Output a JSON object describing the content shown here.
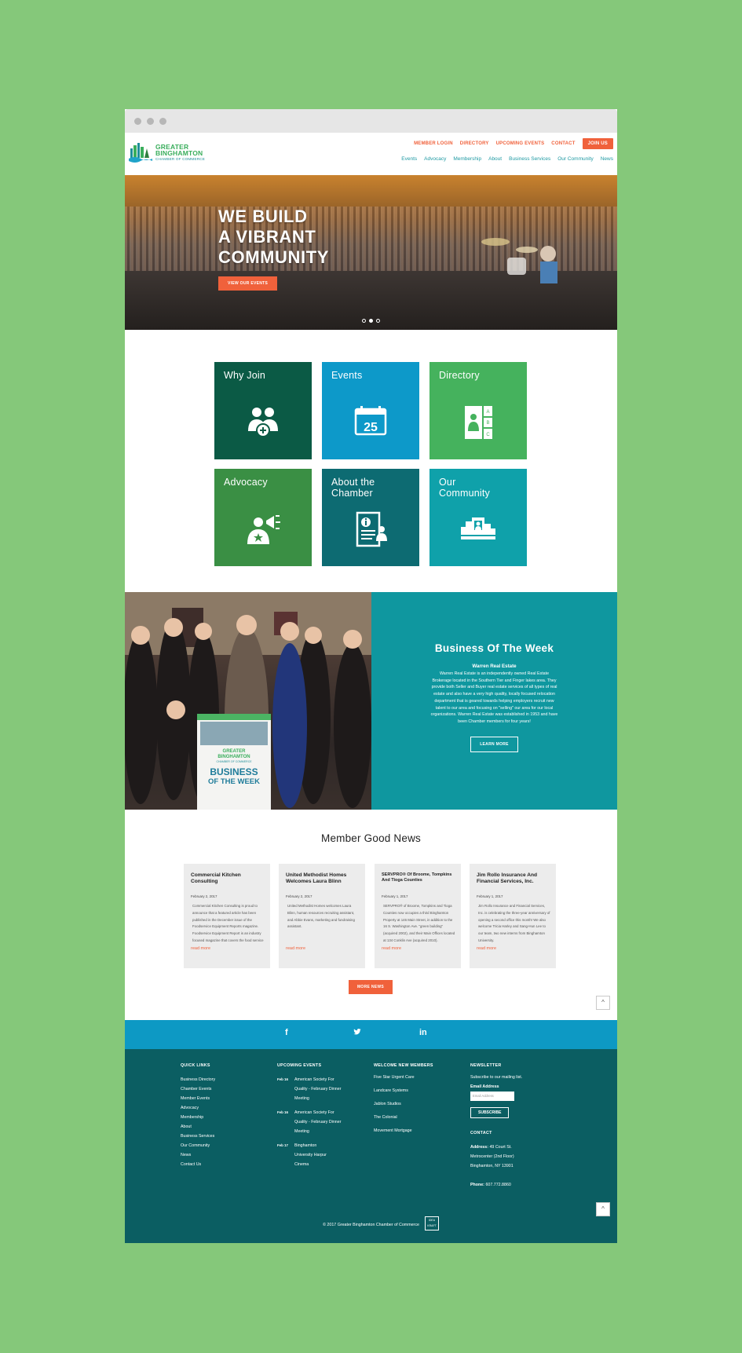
{
  "colors": {
    "background": "#85c87a",
    "accent": "#f0613b",
    "teal": "#0f979f",
    "footer": "#0b5e62",
    "social": "#0d99c4"
  },
  "logo": {
    "line1": "GREATER",
    "line2": "BINGHAMTON",
    "line3": "CHAMBER OF COMMERCE"
  },
  "topnav": [
    "MEMBER LOGIN",
    "DIRECTORY",
    "UPCOMING EVENTS",
    "CONTACT"
  ],
  "join_label": "JOIN US",
  "mainnav": [
    "Events",
    "Advocacy",
    "Membership",
    "About",
    "Business Services",
    "Our Community",
    "News"
  ],
  "hero": {
    "line1": "WE BUILD",
    "line2": "A VIBRANT",
    "line3": "COMMUNITY",
    "button": "VIEW OUR EVENTS"
  },
  "tiles": [
    {
      "label": "Why Join",
      "icon": "people-plus-icon",
      "color": "#0b5a45"
    },
    {
      "label": "Events",
      "icon": "calendar-icon",
      "color": "#0d99c9",
      "day": "25"
    },
    {
      "label": "Directory",
      "icon": "directory-icon",
      "color": "#45b25d"
    },
    {
      "label": "Advocacy",
      "icon": "megaphone-icon",
      "color": "#3a8f44"
    },
    {
      "label1": "About the",
      "label2": "Chamber",
      "icon": "info-document-icon",
      "color": "#0d6b72"
    },
    {
      "label1": "Our",
      "label2": "Community",
      "icon": "city-icon",
      "color": "#0fa1aa"
    }
  ],
  "directory_letters": [
    "A",
    "B",
    "C"
  ],
  "botw": {
    "title": "Business Of The Week",
    "business": "Warren Real Estate",
    "description": "Warren Real Estate is an independently owned Real Estate Brokerage located in the Southern Tier and Finger lakes area. They provide both Seller and Buyer real estate services of all types of real estate and also have a very high quality, locally focused relocation department that is geared towards helping employers recruit new talent to our area and focusing on \"selling\" our area for our local organizations. Warren Real Estate was established in 1953 and have been Chamber members for four years!",
    "button": "LEARN MORE",
    "sign_line1": "GREATER",
    "sign_line2": "BINGHAMTON",
    "sign_line3": "CHAMBER OF COMMERCE",
    "sign_title1": "BUSINESS",
    "sign_title2": "OF THE WEEK"
  },
  "news": {
    "title": "Member Good News",
    "more_label": "read more",
    "button": "MORE NEWS",
    "items": [
      {
        "title": "Commercial Kitchen Consulting",
        "date": "February 2, 2017",
        "body": "Commercial Kitchen Consulting is proud to announce that a featured article has been published in the December issue of the Foodservice Equipment Reports magazine. Foodservice Equipment Report is an industry focused magazine that covers the food service"
      },
      {
        "title": "United Methodist Homes Welcomes Laura Blinn",
        "date": "February 2, 2017",
        "body": "United Methodist Homes welcomes Laura Blinn, human resources recruiting assistant, and Abbie Evans, marketing and fundraising assistant."
      },
      {
        "title": "SERVPRO® Of Broome, Tompkins And Tioga Counties",
        "date": "February 1, 2017",
        "body": "SERVPRO® of Broome, Tompkins and Tioga Counties now occupies a third Binghamton Property at 146 Main Street, in addition to the 16 S. Washington Ave. \"green building\" (acquired 2002), and their Main Offices located at 134 Conklin Ave (acquired 2010)."
      },
      {
        "title": "Jim Rollo Insurance And Financial Services, Inc.",
        "date": "February 1, 2017",
        "body": "Jim Rollo Insurance and Financial Services, Inc. is celebrating the three-year anniversary of opening a second office this month! We also welcome Tricia Harley and Sang-Hun Lee to our team, two new interns from Binghamton University."
      }
    ]
  },
  "social": [
    "f",
    "t",
    "in"
  ],
  "footer": {
    "quick_links_title": "QUICK LINKS",
    "quick_links": [
      "Business Directory",
      "Chamber Events",
      "Member Events",
      "Advocacy",
      "Membership",
      "About",
      "Business Services",
      "Our Community",
      "News",
      "Contact Us"
    ],
    "events_title": "UPCOMING EVENTS",
    "events": [
      {
        "date": "Feb 16",
        "title": "American Society For Quality - February Dinner Meeting"
      },
      {
        "date": "Feb 16",
        "title": "American Society For Quality - February Dinner Meeting"
      },
      {
        "date": "Feb 17",
        "title": "Binghamton University Harpur Cinema"
      }
    ],
    "new_members_title": "WELCOME NEW MEMBERS",
    "new_members": [
      "Five Star Urgent Care",
      "Landcare Systems",
      "Jablon Studios",
      "The Colonial",
      "Movement Mortgage"
    ],
    "newsletter_title": "NEWSLETTER",
    "newsletter_text": "Subscribe to our mailing list.",
    "email_label": "Email Address",
    "email_placeholder": "Email Address",
    "subscribe": "SUBSCRIBE",
    "contact_title": "CONTACT",
    "address_label": "Address:",
    "address1": "49 Court St.",
    "address2": "Metrocenter (2nd Floor)",
    "address3": "Binghamton, NY 13901",
    "phone_label": "Phone:",
    "phone": "607.772.8860",
    "copyright": "© 2017 Greater Binghamton Chamber of Commerce",
    "ideakraft1": "IDEA",
    "ideakraft2": "KRAFT"
  },
  "to_top": "^"
}
